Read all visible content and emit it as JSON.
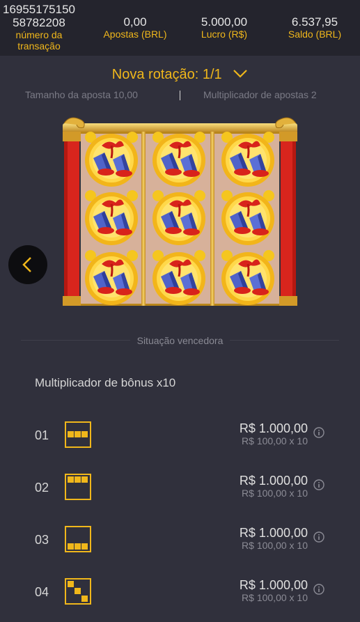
{
  "header": {
    "transaction_id_line1": "16955175150",
    "transaction_id_line2": "58782208",
    "transaction_label_line1": "número da",
    "transaction_label_line2": "transação",
    "bets_value": "0,00",
    "bets_label": "Apostas (BRL)",
    "profit_value": "5.000,00",
    "profit_label": "Lucro (R$)",
    "balance_value": "6.537,95",
    "balance_label": "Saldo (BRL)"
  },
  "rotation": {
    "title": "Nova rotação: 1/1",
    "bet_size": "Tamanho da aposta 10,00",
    "bet_multiplier": "Multiplicador de apostas 2"
  },
  "reels": {
    "symbol": "firecracker-bells",
    "columns": 3,
    "rows": 3
  },
  "winning_situation_label": "Situação vencedora",
  "bonus_multiplier_label": "Multiplicador de bônus x10",
  "paylines": [
    {
      "number": "01",
      "pattern": "middle-row",
      "amount": "R$ 1.000,00",
      "detail": "R$ 100,00 x 10"
    },
    {
      "number": "02",
      "pattern": "top-row",
      "amount": "R$ 1.000,00",
      "detail": "R$ 100,00 x 10"
    },
    {
      "number": "03",
      "pattern": "bottom-row",
      "amount": "R$ 1.000,00",
      "detail": "R$ 100,00 x 10"
    },
    {
      "number": "04",
      "pattern": "diagonal-down",
      "amount": "R$ 1.000,00",
      "detail": "R$ 100,00 x 10"
    }
  ],
  "colors": {
    "accent": "#f0b71b",
    "background": "#30303c",
    "header_background": "#24242d"
  },
  "icons": {
    "expand": "chevron-down-icon",
    "back": "chevron-left-icon",
    "info": "info-icon"
  }
}
